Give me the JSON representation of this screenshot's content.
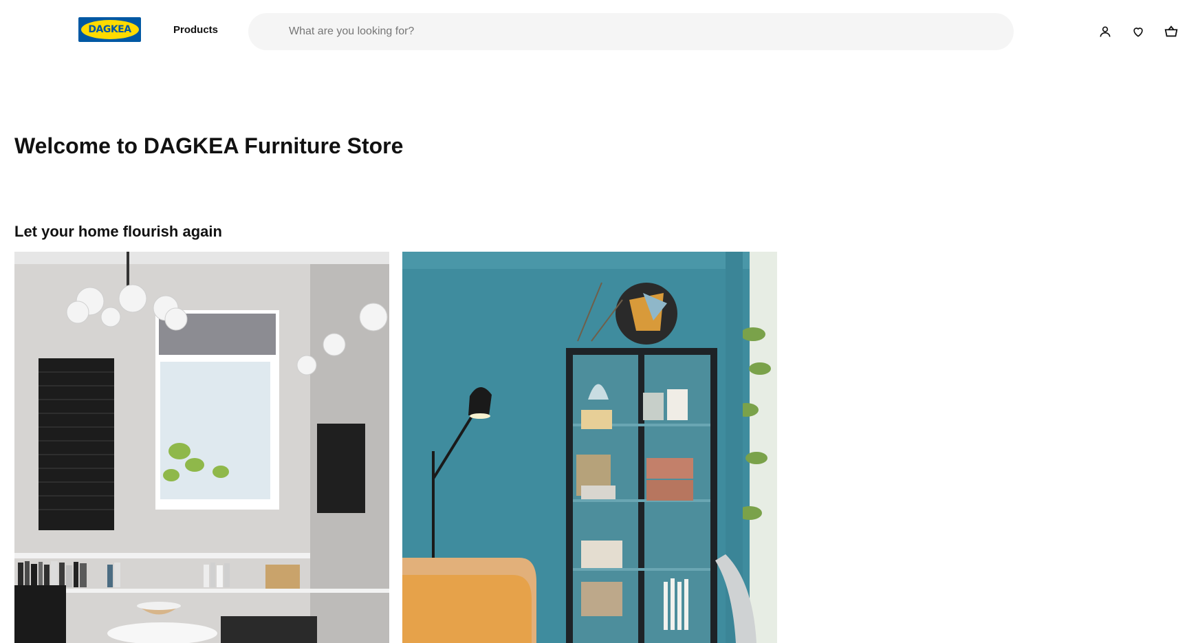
{
  "header": {
    "logo_text": "DAGKEA",
    "nav_products": "Products",
    "search": {
      "placeholder": "What are you looking for?",
      "value": ""
    },
    "icons": [
      "account-icon",
      "heart-icon",
      "shopping-bag-icon"
    ]
  },
  "main": {
    "title": "Welcome to DAGKEA Furniture Store",
    "section_title": "Let your home flourish again",
    "cards": [
      {
        "image": "living-room-photo"
      },
      {
        "image": "teal-room-cabinet-photo"
      }
    ]
  },
  "colors": {
    "brand_blue": "#0058a3",
    "brand_yellow": "#ffdb00",
    "search_bg": "#f5f5f5",
    "text": "#111111",
    "placeholder": "#767676"
  }
}
